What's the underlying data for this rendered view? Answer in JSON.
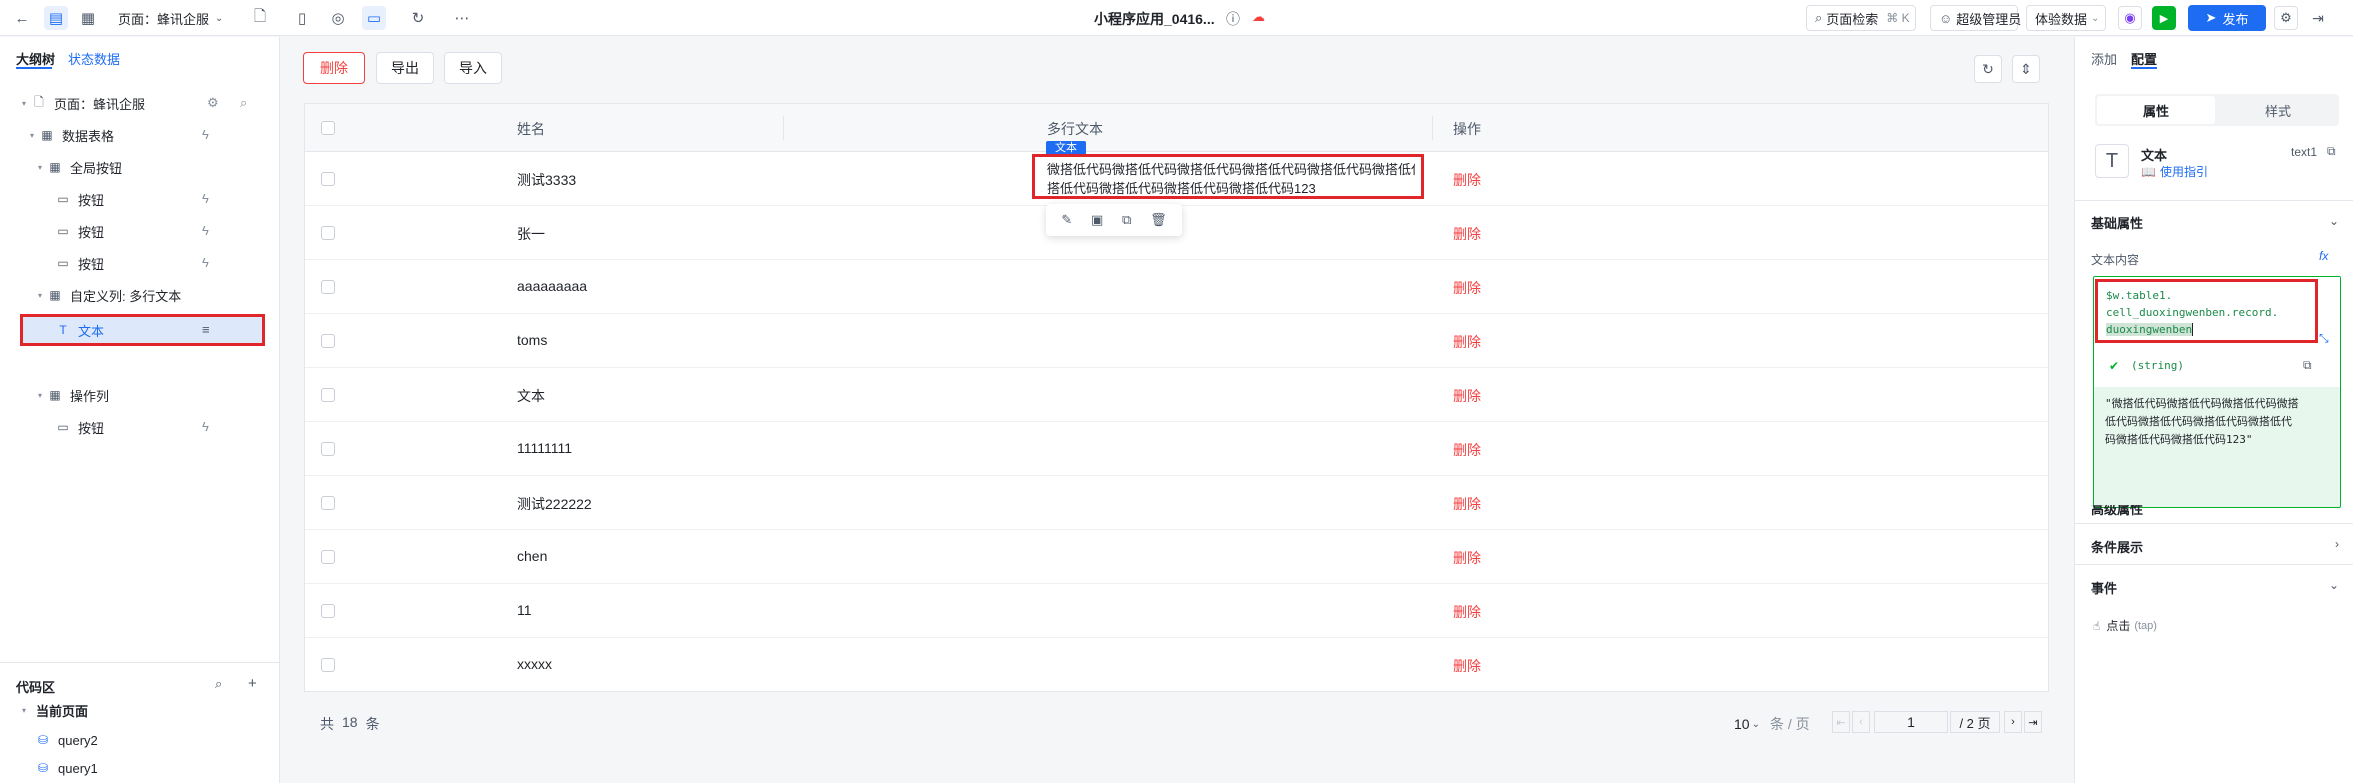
{
  "topbar": {
    "page_label": "页面：蜂讯企服",
    "app_title": "小程序应用_0416...",
    "search_label": "页面检索",
    "search_shortcut": "⌘ K",
    "admin_label": "超级管理员",
    "exp_data_label": "体验数据",
    "publish_label": "发布"
  },
  "left": {
    "tabs": [
      "大纲树",
      "状态数据"
    ],
    "tree": [
      {
        "label": "页面：蜂讯企服",
        "icon": "page-icon"
      },
      {
        "label": "数据表格",
        "icon": "table-icon"
      },
      {
        "label": "全局按钮",
        "icon": "table-icon"
      },
      {
        "label": "按钮",
        "icon": "button-icon"
      },
      {
        "label": "按钮",
        "icon": "button-icon"
      },
      {
        "label": "按钮",
        "icon": "button-icon"
      },
      {
        "label": "自定义列: 多行文本",
        "icon": "table-icon"
      },
      {
        "label": "文本",
        "icon": "text-icon"
      },
      {
        "label": "操作列",
        "icon": "table-icon"
      },
      {
        "label": "按钮",
        "icon": "button-icon"
      }
    ],
    "code_title": "代码区",
    "current_page": "当前页面",
    "queries": [
      "query2",
      "query1"
    ]
  },
  "toolbar": {
    "delete_label": "删除",
    "export_label": "导出",
    "import_label": "导入"
  },
  "table": {
    "headers": [
      "姓名",
      "多行文本",
      "操作"
    ],
    "rows": [
      {
        "name": "测试3333",
        "text": "微搭低代码微搭低代码微搭低代码微搭低代码微搭低代码微搭低代码微搭低代码微搭低代码微搭低代码123",
        "action": "删除"
      },
      {
        "name": "张一",
        "text": "",
        "action": "删除"
      },
      {
        "name": "aaaaaaaaa",
        "text": "",
        "action": "删除"
      },
      {
        "name": "toms",
        "text": "",
        "action": "删除"
      },
      {
        "name": "文本",
        "text": "",
        "action": "删除"
      },
      {
        "name": "11111111",
        "text": "",
        "action": "删除"
      },
      {
        "name": "测试222222",
        "text": "",
        "action": "删除"
      },
      {
        "name": "chen",
        "text": "",
        "action": "删除"
      },
      {
        "name": "11",
        "text": "",
        "action": "删除"
      },
      {
        "name": "xxxxx",
        "text": "",
        "action": "删除"
      }
    ],
    "text_line1": "微搭低代码微搭低代码微搭低代码微搭低代码微搭低代码微搭低代码微搭",
    "text_line2": "搭低代码微搭低代码微搭低代码微搭低代码123",
    "selected_tag": "文本"
  },
  "pager": {
    "total_prefix": "共",
    "total": "18",
    "total_suffix": "条",
    "page_size": "10",
    "page_size_suffix": "条 / 页",
    "current_page": "1",
    "total_pages": "/ 2 页"
  },
  "right": {
    "tabs": [
      "添加",
      "配置"
    ],
    "segment": [
      "属性",
      "样式"
    ],
    "component_name": "文本",
    "component_id": "text1",
    "guide_label": "使用指引",
    "basic_props": "基础属性",
    "text_content_label": "文本内容",
    "expr_line1": "$w.table1.",
    "expr_line2": "cell_duoxingwenben.record.",
    "expr_line3": "duoxingwenben",
    "type_label": "(string)",
    "preview_value": "\"微搭低代码微搭低代码微搭低代码微搭低代码微搭低代码微搭低代码微搭低代码微搭低代码微搭低代码123\"",
    "preview_line1": "\"微搭低代码微搭低代码微搭低代码微搭",
    "preview_line2": "低代码微搭低代码微搭低代码微搭低代",
    "preview_line3": "码微搭低代码微搭低代码123\"",
    "advanced_props": "高级属性",
    "conditional": "条件展示",
    "events": "事件",
    "event_item": "点击",
    "event_tag": "(tap)"
  },
  "colors": {
    "accent": "#1d6cf2",
    "danger": "#f53f3f",
    "highlight": "#e8f0fe",
    "success_bg": "#e8f7ee",
    "success": "#00b42a"
  }
}
